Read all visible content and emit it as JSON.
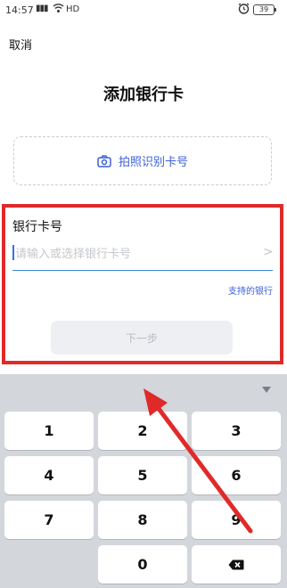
{
  "status_bar": {
    "time": "14:57",
    "signal": "▮▮▮",
    "network": "HD",
    "battery": "39",
    "icons": [
      "signal-icon",
      "wifi-icon",
      "alarm-icon",
      "battery-icon"
    ]
  },
  "header": {
    "cancel_label": "取消",
    "title": "添加银行卡"
  },
  "photo_recognize": {
    "label": "拍照识别卡号",
    "icon": "camera-icon"
  },
  "card_form": {
    "label": "银行卡号",
    "placeholder": "请输入或选择银行卡号",
    "value": "",
    "supported_banks_link": "支持的银行",
    "next_button": "下一步",
    "next_enabled": false
  },
  "keypad": {
    "keys": [
      "1",
      "2",
      "3",
      "4",
      "5",
      "6",
      "7",
      "8",
      "9",
      "0"
    ],
    "collapse_icon": "chevron-down-icon",
    "backspace_icon": "backspace-icon"
  },
  "colors": {
    "accent": "#3a5fd9",
    "highlight_frame": "#e02a2a",
    "keypad_bg": "#d3d6db"
  }
}
